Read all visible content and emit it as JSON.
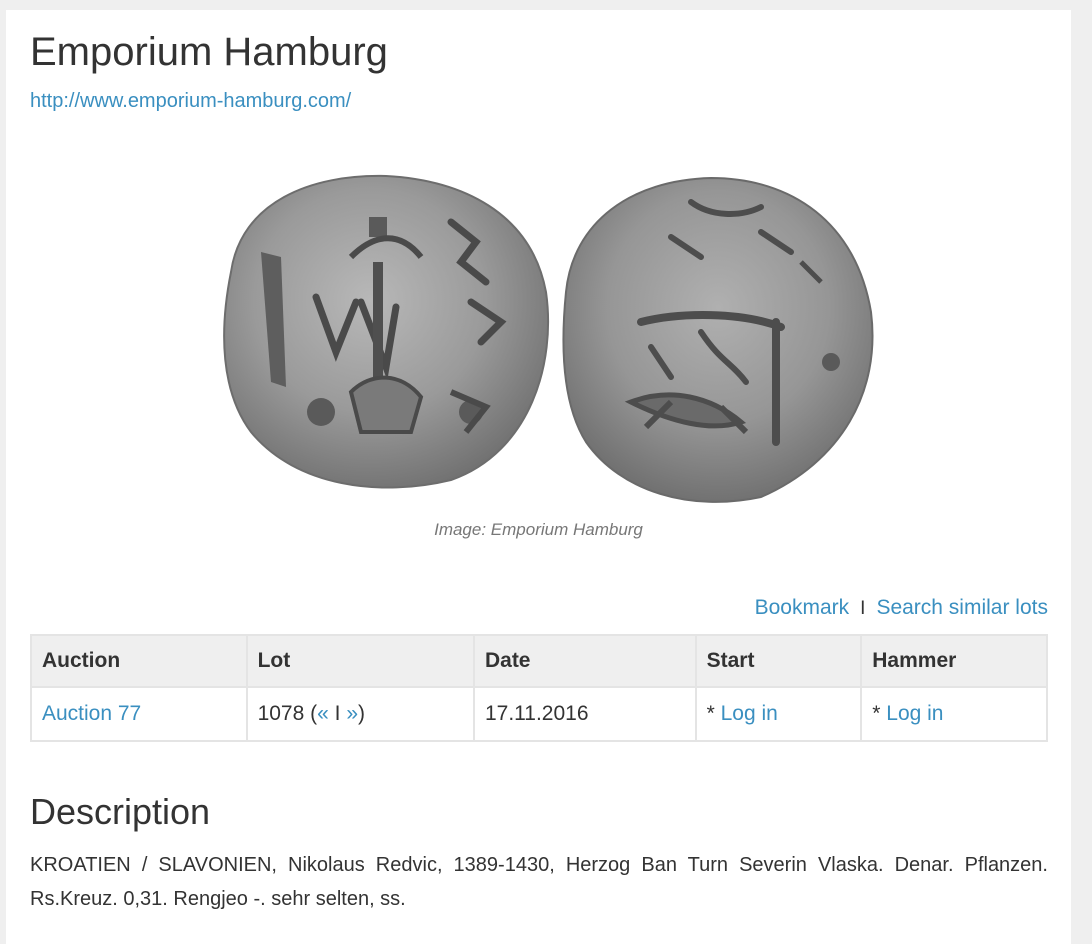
{
  "header": {
    "title": "Emporium Hamburg",
    "url_text": "http://www.emporium-hamburg.com/"
  },
  "image": {
    "caption": "Image: Emporium Hamburg",
    "description_alt": "coin obverse and reverse"
  },
  "actions": {
    "bookmark": "Bookmark",
    "separator": "I",
    "search_similar": "Search similar lots"
  },
  "lot_table": {
    "headers": [
      "Auction",
      "Lot",
      "Date",
      "Start",
      "Hammer"
    ],
    "row": {
      "auction": "Auction 77",
      "lot_number": "1078",
      "lot_open": "(",
      "lot_prev": "«",
      "lot_sep": " I ",
      "lot_next": "»",
      "lot_close": ")",
      "date": "17.11.2016",
      "start_prefix": "* ",
      "start_link": "Log in",
      "hammer_prefix": "* ",
      "hammer_link": "Log in"
    }
  },
  "description": {
    "heading": "Description",
    "text": "KROATIEN / SLAVONIEN, Nikolaus Redvic, 1389-1430, Herzog Ban Turn Severin Vlaska. Denar. Pflanzen. Rs.Kreuz. 0,31. Rengjeo -. sehr selten, ss."
  },
  "colors": {
    "link": "#3a8fc0",
    "text": "#333333",
    "background": "#efefef",
    "table_header_bg": "#efefef"
  }
}
